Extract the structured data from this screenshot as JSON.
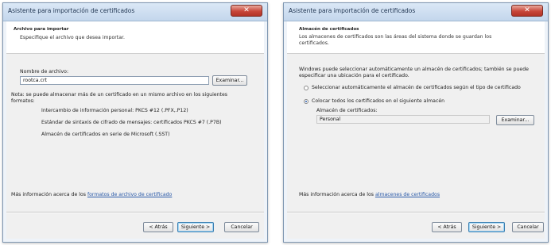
{
  "left_dialog": {
    "title": "Asistente para importación de certificados",
    "close": "✕",
    "header_title": "Archivo para importar",
    "header_subtitle": "Especifique el archivo que desea importar.",
    "filename_label": "Nombre de archivo:",
    "filename_value": "rootca.crt",
    "browse_button": "Examinar...",
    "note": "Nota: se puede almacenar más de un certificado en un mismo archivo en los siguientes formatos:",
    "formats": [
      "Intercambio de información personal: PKCS #12 (.PFX,.P12)",
      "Estándar de sintaxis de cifrado de mensajes: certificados PKCS #7 (.P7B)",
      "Almacén de certificados en serie de Microsoft (.SST)"
    ],
    "more_info_text": "Más información acerca de los ",
    "more_info_link": "formatos de archivo de certificado",
    "back_button": "< Atrás",
    "next_button": "Siguiente >",
    "cancel_button": "Cancelar"
  },
  "right_dialog": {
    "title": "Asistente para importación de certificados",
    "close": "✕",
    "header_title": "Almacén de certificados",
    "header_subtitle": "Los almacenes de certificados son las áreas del sistema donde se guardan los certificados.",
    "description": "Windows puede seleccionar automáticamente un almacén de certificados; también se puede especificar una ubicación para el certificado.",
    "radio_auto": "Seleccionar automáticamente el almacén de certificados según el tipo de certificado",
    "radio_manual": "Colocar todos los certificados en el siguiente almacén",
    "selected_option": "manual",
    "store_label": "Almacén de certificados:",
    "store_value": "Personal",
    "browse_button": "Examinar...",
    "more_info_text": "Más información acerca de los ",
    "more_info_link": "almacenes de certificados",
    "back_button": "< Atrás",
    "next_button": "Siguiente >",
    "cancel_button": "Cancelar"
  }
}
